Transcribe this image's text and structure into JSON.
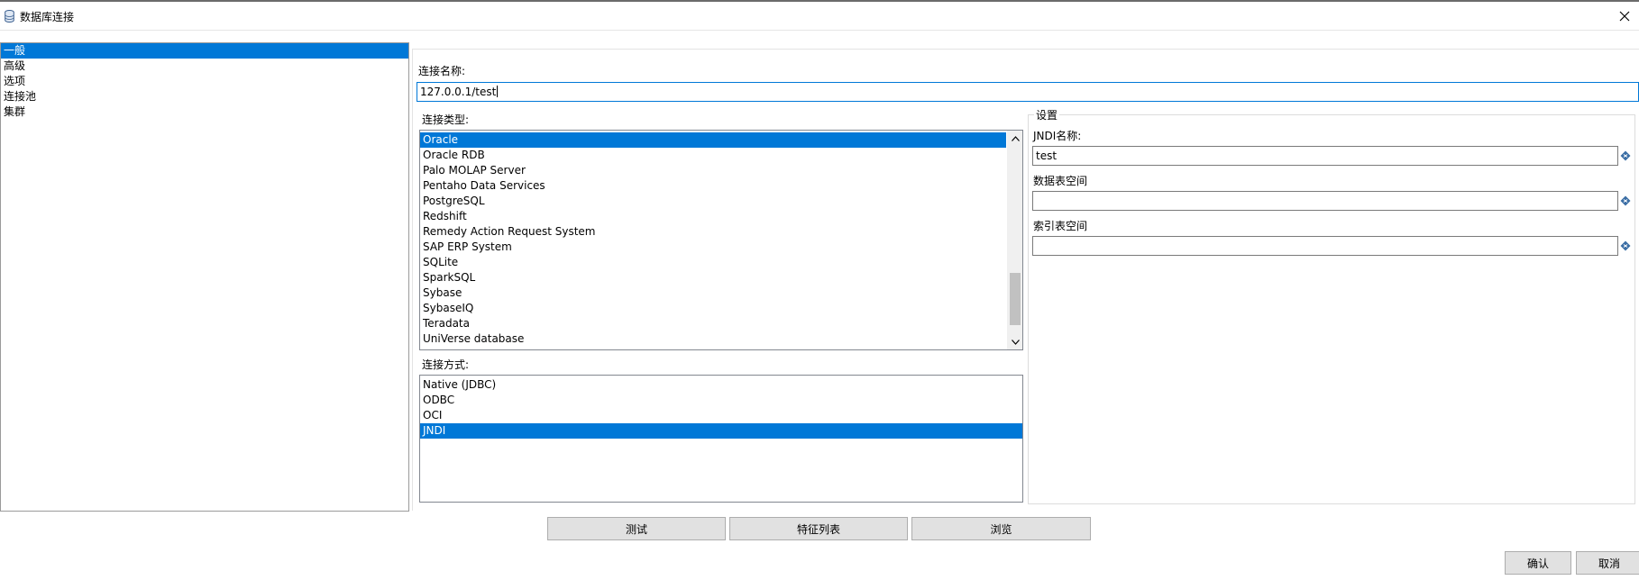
{
  "window": {
    "title": "数据库连接",
    "icon": "database-icon",
    "close_icon": "close-icon"
  },
  "nav": {
    "items": [
      {
        "label": "一般",
        "selected": true
      },
      {
        "label": "高级",
        "selected": false
      },
      {
        "label": "选项",
        "selected": false
      },
      {
        "label": "连接池",
        "selected": false
      },
      {
        "label": "集群",
        "selected": false
      }
    ]
  },
  "connection_name": {
    "label": "连接名称:",
    "value": "127.0.0.1/test"
  },
  "connection_type": {
    "label": "连接类型:",
    "items": [
      "Oracle",
      "Oracle RDB",
      "Palo MOLAP Server",
      "Pentaho Data Services",
      "PostgreSQL",
      "Redshift",
      "Remedy Action Request System",
      "SAP ERP System",
      "SQLite",
      "SparkSQL",
      "Sybase",
      "SybaseIQ",
      "Teradata",
      "UniVerse database"
    ],
    "selected": "Oracle"
  },
  "access_method": {
    "label": "连接方式:",
    "items": [
      "Native (JDBC)",
      "ODBC",
      "OCI",
      "JNDI"
    ],
    "selected": "JNDI"
  },
  "settings": {
    "legend": "设置",
    "jndi_name_label": "JNDI名称:",
    "jndi_name_value": "test",
    "data_tablespace_label": "数据表空间",
    "data_tablespace_value": "",
    "index_tablespace_label": "索引表空间",
    "index_tablespace_value": "",
    "variable_icon": "variable-diamond-icon"
  },
  "buttons": {
    "test": "测试",
    "feature_list": "特征列表",
    "explore": "浏览",
    "ok": "确认",
    "cancel": "取消"
  },
  "colors": {
    "selection": "#0078d7",
    "variable_icon": "#3b6ea5"
  }
}
